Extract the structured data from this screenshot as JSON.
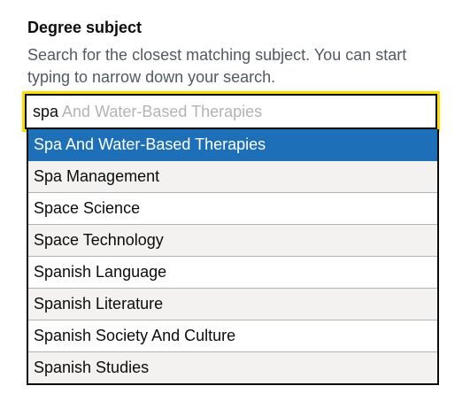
{
  "field": {
    "label": "Degree subject",
    "hint": "Search for the closest matching subject. You can start typing to narrow down your search."
  },
  "input": {
    "typed": "spa",
    "suggestion_completion": " And Water-Based Therapies"
  },
  "options": [
    {
      "label": "Spa And Water-Based Therapies",
      "selected": true
    },
    {
      "label": "Spa Management",
      "selected": false
    },
    {
      "label": "Space Science",
      "selected": false
    },
    {
      "label": "Space Technology",
      "selected": false
    },
    {
      "label": "Spanish Language",
      "selected": false
    },
    {
      "label": "Spanish Literature",
      "selected": false
    },
    {
      "label": "Spanish Society And Culture",
      "selected": false
    },
    {
      "label": "Spanish Studies",
      "selected": false
    }
  ],
  "colors": {
    "focus_outline": "#ffdd00",
    "selected_bg": "#1d70b8",
    "hint_text": "#505a5f",
    "suggestion_text": "#b1b4b6"
  }
}
